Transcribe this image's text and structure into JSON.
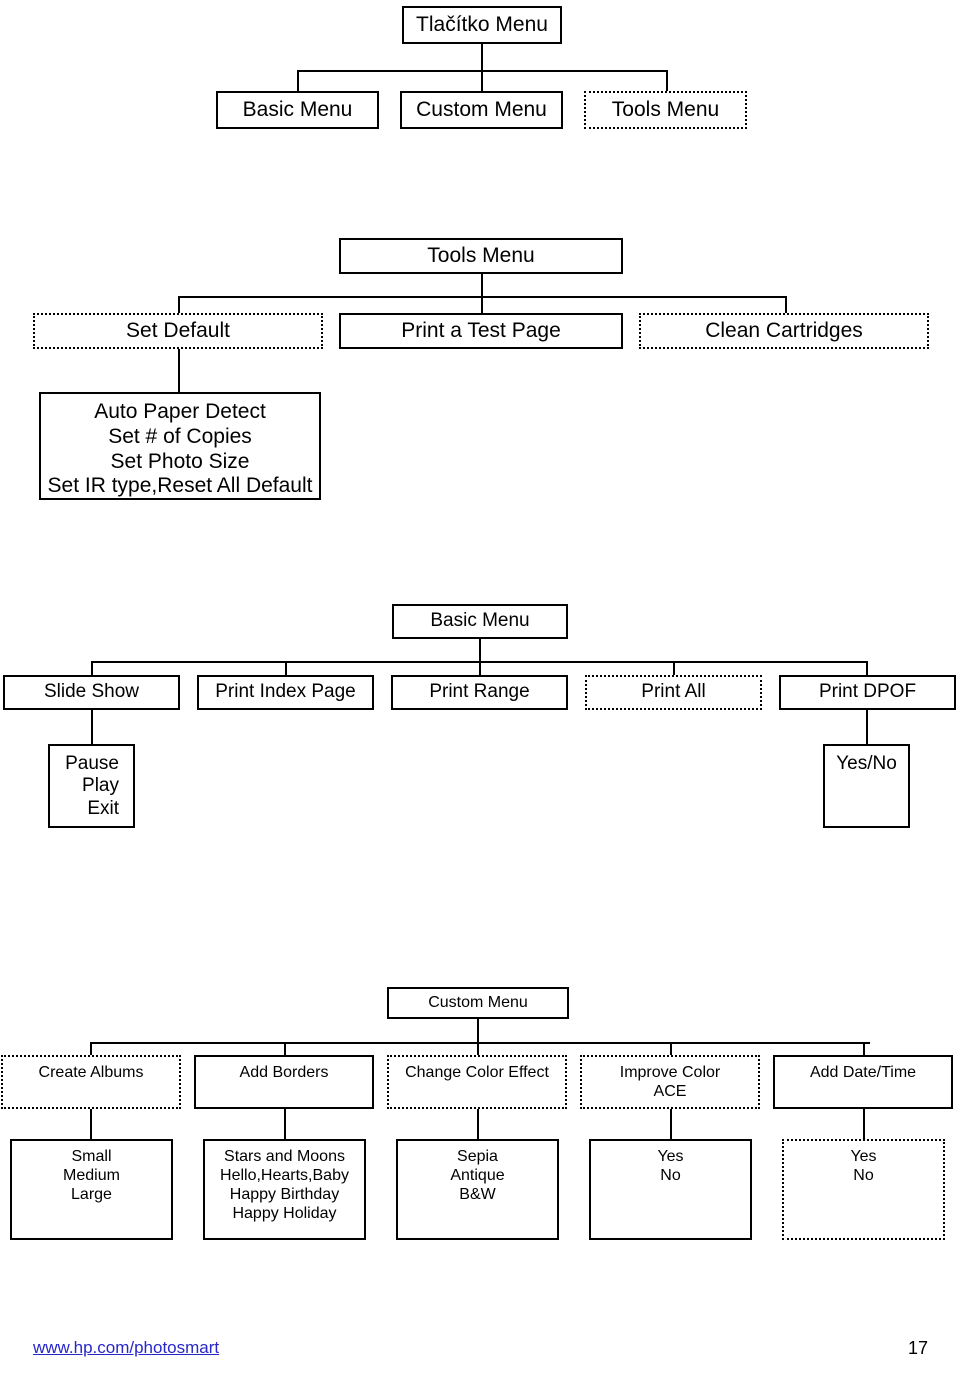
{
  "diagram": {
    "title_node": {
      "label": "Tlačítko Menu"
    },
    "top_row": [
      {
        "label": "Basic Menu",
        "border": "solid"
      },
      {
        "label": "Custom Menu",
        "border": "solid"
      },
      {
        "label": "Tools Menu",
        "border": "dotted"
      }
    ],
    "tools_section": {
      "header": {
        "label": "Tools Menu",
        "border": "solid"
      },
      "children": [
        {
          "label": "Set Default",
          "border": "dotted"
        },
        {
          "label": "Print a Test Page",
          "border": "solid"
        },
        {
          "label": "Clean Cartridges",
          "border": "dotted"
        }
      ],
      "set_default_options": {
        "label": "Auto Paper Detect\nSet # of Copies\nSet Photo Size\nSet IR type,Reset All Default",
        "border": "solid"
      }
    },
    "basic_section": {
      "header": {
        "label": "Basic Menu",
        "border": "solid"
      },
      "children": [
        {
          "label": "Slide Show",
          "border": "solid"
        },
        {
          "label": "Print Index Page",
          "border": "solid"
        },
        {
          "label": "Print Range",
          "border": "solid"
        },
        {
          "label": "Print All",
          "border": "dotted"
        },
        {
          "label": "Print DPOF",
          "border": "solid"
        }
      ],
      "slide_show_options": {
        "label": "Pause\nPlay\nExit",
        "border": "solid"
      },
      "dpof_options": {
        "label": "Yes/No",
        "border": "solid"
      }
    },
    "custom_section": {
      "header": {
        "label": "Custom Menu",
        "border": "solid"
      },
      "children": [
        {
          "label": "Create Albums",
          "border": "dotted"
        },
        {
          "label": "Add Borders",
          "border": "solid"
        },
        {
          "label": "Change Color Effect",
          "border": "dotted"
        },
        {
          "label": "Improve Color\nACE",
          "border": "dotted"
        },
        {
          "label": "Add Date/Time",
          "border": "solid"
        }
      ],
      "options": [
        {
          "label": "Small\nMedium\nLarge",
          "border": "solid"
        },
        {
          "label": "Stars and Moons\nHello,Hearts,Baby\nHappy Birthday\nHappy Holiday",
          "border": "solid"
        },
        {
          "label": "Sepia\nAntique\nB&W",
          "border": "solid"
        },
        {
          "label": "Yes\nNo",
          "border": "solid"
        },
        {
          "label": "Yes\nNo",
          "border": "dotted"
        }
      ]
    }
  },
  "footer": {
    "link": "www.hp.com/photosmart",
    "page_number": "17"
  }
}
